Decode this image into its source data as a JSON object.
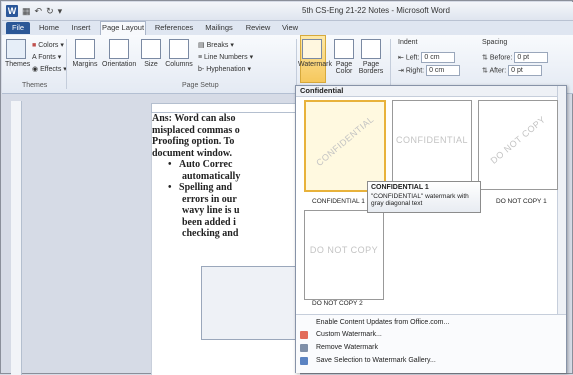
{
  "window": {
    "title": "5th CS-Eng 21-22 Notes - Microsoft Word"
  },
  "tabs": [
    "File",
    "Home",
    "Insert",
    "Page Layout",
    "References",
    "Mailings",
    "Review",
    "View"
  ],
  "ribbon": {
    "themes": {
      "themes": "Themes",
      "colors": "Colors",
      "fonts": "Fonts",
      "effects": "Effects",
      "group": "Themes"
    },
    "page_setup": {
      "margins": "Margins",
      "orientation": "Orientation",
      "size": "Size",
      "columns": "Columns",
      "breaks": "Breaks",
      "line_numbers": "Line Numbers",
      "hyphenation": "Hyphenation",
      "group": "Page Setup"
    },
    "background": {
      "watermark": "Watermark",
      "page_color": "Page Color",
      "page_borders": "Page Borders"
    },
    "paragraph": {
      "indent": "Indent",
      "spacing": "Spacing",
      "left": "Left:",
      "right": "Right:",
      "before": "Before:",
      "after": "After:",
      "left_val": "0 cm",
      "right_val": "0 cm",
      "before_val": "0 pt",
      "after_val": "0 pt"
    }
  },
  "document": {
    "lines": [
      "Ans: Word can also",
      "misplaced commas o",
      "Proofing option. To",
      "document window."
    ],
    "bullets": [
      {
        "lines": [
          "Auto Correc",
          "automatically"
        ]
      },
      {
        "lines": [
          "Spelling and",
          "errors in our",
          "wavy line is u",
          "been added i",
          "checking and"
        ]
      }
    ]
  },
  "gallery": {
    "header": "Confidential",
    "items": [
      {
        "wm": "CONFIDENTIAL",
        "label": "CONFIDENTIAL 1"
      },
      {
        "wm": "CONFIDENTIAL",
        "label": ""
      },
      {
        "wm": "DO NOT COPY",
        "label": "DO NOT COPY 1"
      },
      {
        "wm": "DO NOT COPY",
        "label": "DO NOT COPY 2"
      }
    ],
    "tooltip": {
      "title": "CONFIDENTIAL 1",
      "text": "\"CONFIDENTIAL\" watermark with gray diagonal text"
    },
    "menu": [
      "Enable Content Updates from Office.com...",
      "Custom Watermark...",
      "Remove Watermark",
      "Save Selection to Watermark Gallery..."
    ]
  },
  "colors": {
    "accent": "#2b579a",
    "selection": "#e8b23b"
  }
}
